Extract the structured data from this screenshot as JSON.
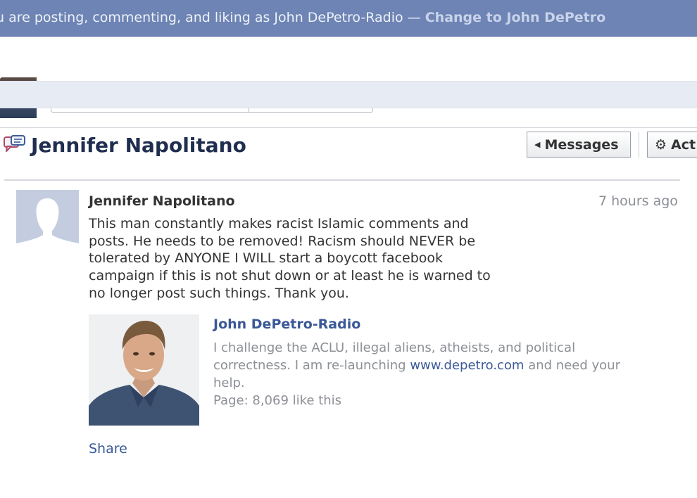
{
  "banner": {
    "text": "u are posting, commenting, and liking as John DePetro-Radio — ",
    "link": "Change to John DePetro"
  },
  "thread": {
    "title": "Jennifer Napolitano",
    "messages_button": "Messages",
    "actions_button": "Act"
  },
  "message": {
    "sender": "Jennifer Napolitano",
    "timestamp": "7 hours ago",
    "body_lines": [
      "This man constantly makes racist Islamic comments and",
      "posts. He needs to be removed! Racism should NEVER be",
      "tolerated by ANYONE I WILL start a boycott facebook",
      "campaign if this is not shut down or at least he is warned to",
      "no longer post such things. Thank you."
    ]
  },
  "attachment": {
    "title": "John DePetro-Radio",
    "line1": "I challenge the ACLU, illegal aliens, atheists, and political",
    "line2_before": "correctness. I am re-launching ",
    "line2_link": "www.depetro.com",
    "line2_after": " and need your",
    "line3": "help.",
    "stats": "Page: 8,069 like this"
  },
  "share_label": "Share",
  "colors": {
    "banner_bg": "#6d84b4",
    "link": "#3b5998",
    "title": "#1f2d4f",
    "muted": "#8c8f95"
  },
  "icons": {
    "thread": "messages-icon",
    "messages_caret": "caret-left-icon",
    "actions": "gear-icon"
  }
}
